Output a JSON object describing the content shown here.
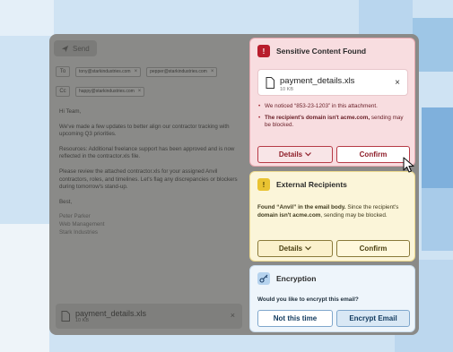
{
  "composer": {
    "send_label": "Send",
    "to_label": "To",
    "to_recipients": [
      "tony@starkindustries.com",
      "pepper@starkindustries.com"
    ],
    "cc_label": "Cc",
    "cc_recipients": [
      "happy@starkindustries.com"
    ],
    "greeting": "Hi Team,",
    "para1": "We've made a few updates to better align our contractor tracking with upcoming Q3 priorities.",
    "para2": "Resources: Additional freelance support has been approved and is now reflected in the contractor.xls file.",
    "para3": "Please review the attached contractor.xls for your assigned Anvil contractors, roles, and timelines. Let's flag any discrepancies or blockers during tomorrow's stand-up.",
    "closing": "Best,",
    "sig_name": "Peter Parker",
    "sig_title": "Web Management",
    "sig_company": "Stark Industries",
    "attachment_name": "payment_details.xls",
    "attachment_size": "10 KB"
  },
  "sensitive": {
    "title": "Sensitive Content Found",
    "file_name": "payment_details.xls",
    "file_size": "10 KB",
    "bullet1": "We noticed “853-23-1203” in this attachment.",
    "bullet2_bold": "The recipient's domain isn't acme.com,",
    "bullet2_rest": " sending may be blocked.",
    "details_label": "Details",
    "confirm_label": "Confirm"
  },
  "external": {
    "title": "External Recipients",
    "msg_bold1": "Found “Anvil” in the email body.",
    "msg_mid": " Since the recipient's ",
    "msg_bold2": "domain isn't acme.com",
    "msg_end": ", sending may be blocked.",
    "details_label": "Details",
    "confirm_label": "Confirm"
  },
  "encryption": {
    "title": "Encryption",
    "question": "Would you like to encrypt this email?",
    "no_label": "Not this time",
    "encrypt_label": "Encrypt Email"
  },
  "colors": {
    "alert": "#b81d2c",
    "warning": "#e9c332",
    "info": "#b6d3ee"
  }
}
